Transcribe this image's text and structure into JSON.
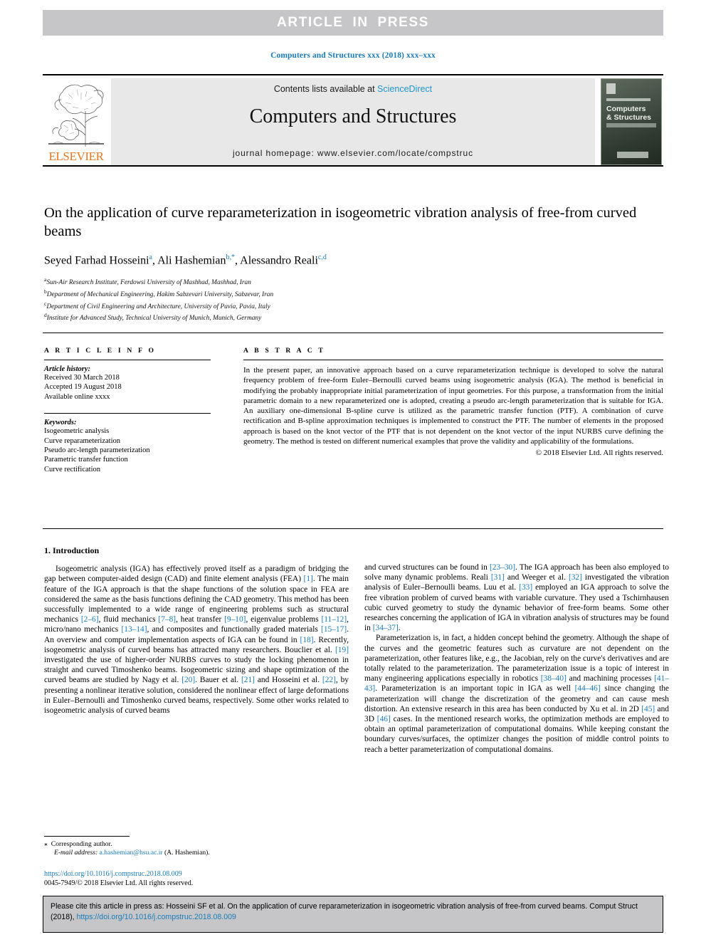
{
  "banner": {
    "text": "ARTICLE IN PRESS"
  },
  "journal_citation": "Computers and Structures xxx (2018) xxx–xxx",
  "masthead": {
    "contents_prefix": "Contents lists available at ",
    "sciencedirect": "ScienceDirect",
    "journal_name": "Computers and Structures",
    "homepage": "journal homepage: www.elsevier.com/locate/compstruc",
    "publisher_logo_text": "ELSEVIER",
    "cover": {
      "title_line1": "Computers",
      "title_line2": "& Structures"
    }
  },
  "article": {
    "title": "On the application of curve reparameterization in isogeometric vibration analysis of free-from curved beams",
    "authors_html": "Seyed Farhad Hosseini<sup>a</sup>, Ali Hashemian<sup>b,*</sup>, Alessandro Reali<sup>c,d</sup>",
    "affiliations": [
      {
        "marker": "a",
        "text": "Sun-Air Research Institute, Ferdowsi University of Mashhad, Mashhad, Iran"
      },
      {
        "marker": "b",
        "text": "Department of Mechanical Engineering, Hakim Sabzevari University, Sabzevar, Iran"
      },
      {
        "marker": "c",
        "text": "Department of Civil Engineering and Architecture, University of Pavia, Pavia, Italy"
      },
      {
        "marker": "d",
        "text": "Institute for Advanced Study, Technical University of Munich, Munich, Germany"
      }
    ]
  },
  "article_info": {
    "heading": "A R T I C L E   I N F O",
    "history_label": "Article history:",
    "history": [
      "Received 30 March 2018",
      "Accepted 19 August 2018",
      "Available online xxxx"
    ],
    "keywords_label": "Keywords:",
    "keywords": [
      "Isogeometric analysis",
      "Curve reparameterization",
      "Pseudo arc-length parameterization",
      "Parametric transfer function",
      "Curve rectification"
    ]
  },
  "abstract": {
    "heading": "A B S T R A C T",
    "text": "In the present paper, an innovative approach based on a curve reparameterization technique is developed to solve the natural frequency problem of free-form Euler–Bernoulli curved beams using isogeometric analysis (IGA). The method is beneficial in modifying the probably inappropriate initial parameterization of input geometries. For this purpose, a transformation from the initial parametric domain to a new reparameterized one is adopted, creating a pseudo arc-length parameterization that is suitable for IGA. An auxiliary one-dimensional B-spline curve is utilized as the parametric transfer function (PTF). A combination of curve rectification and B-spline approximation techniques is implemented to construct the PTF. The number of elements in the proposed approach is based on the knot vector of the PTF that is not dependent on the knot vector of the input NURBS curve defining the geometry. The method is tested on different numerical examples that prove the validity and applicability of the formulations.",
    "copyright": "© 2018 Elsevier Ltd. All rights reserved."
  },
  "body": {
    "section_title": "1. Introduction",
    "left_paragraphs_html": [
      "Isogeometric analysis (IGA) has effectively proved itself as a paradigm of bridging the gap between computer-aided design (CAD) and finite element analysis (FEA) <span class=\"ref\">[1]</span>. The main feature of the IGA approach is that the shape functions of the solution space in FEA are considered the same as the basis functions defining the CAD geometry. This method has been successfully implemented to a wide range of engineering problems such as structural mechanics <span class=\"ref\">[2&#8211;6]</span>, fluid mechanics <span class=\"ref\">[7&#8211;8]</span>, heat transfer <span class=\"ref\">[9&#8211;10]</span>, eigenvalue problems <span class=\"ref\">[11&#8211;12]</span>, micro/nano mechanics <span class=\"ref\">[13&#8211;14]</span>, and composites and functionally graded materials <span class=\"ref\">[15&#8211;17]</span>. An overview and computer implementation aspects of IGA can be found in <span class=\"ref\">[18]</span>. Recently, isogeometric analysis of curved beams has attracted many researchers. Bouclier et al. <span class=\"ref\">[19]</span> investigated the use of higher-order NURBS curves to study the locking phenomenon in straight and curved Timoshenko beams. Isogeometric sizing and shape optimization of the curved beams are studied by Nagy et al. <span class=\"ref\">[20]</span>. Bauer et al. <span class=\"ref\">[21]</span> and Hosseini et al. <span class=\"ref\">[22]</span>, by presenting a nonlinear iterative solution, considered the nonlinear effect of large deformations in Euler&#8211;Bernoulli and Timoshenko curved beams, respectively. Some other works related to isogeometric analysis of curved beams"
    ],
    "right_paragraphs_html": [
      "and curved structures can be found in <span class=\"ref\">[23&#8211;30]</span>. The IGA approach has been also employed to solve many dynamic problems. Reali <span class=\"ref\">[31]</span> and Weeger et al. <span class=\"ref\">[32]</span> investigated the vibration analysis of Euler&#8211;Bernoulli beams. Luu et al. <span class=\"ref\">[33]</span> employed an IGA approach to solve the free vibration problem of curved beams with variable curvature. They used a Tschirnhausen cubic curved geometry to study the dynamic behavior of free-form beams. Some other researches concerning the application of IGA in vibration analysis of structures may be found in <span class=\"ref\">[34&#8211;37]</span>.",
      "Parameterization is, in fact, a hidden concept behind the geometry. Although the shape of the curves and the geometric features such as curvature are not dependent on the parameterization, other features like, e.g., the Jacobian, rely on the curve's derivatives and are totally related to the parameterization. The parameterization issue is a topic of interest in many engineering applications especially in robotics <span class=\"ref\">[38&#8211;40]</span> and machining processes <span class=\"ref\">[41&#8211;43]</span>. Parameterization is an important topic in IGA as well <span class=\"ref\">[44&#8211;46]</span> since changing the parameterization will change the discretization of the geometry and can cause mesh distortion. An extensive research in this area has been conducted by Xu et al. in 2D <span class=\"ref\">[45]</span> and 3D <span class=\"ref\">[46]</span> cases. In the mentioned research works, the optimization methods are employed to obtain an optimal parameterization of computational domains. While keeping constant the boundary curves/surfaces, the optimizer changes the position of middle control points to reach a better parameterization of computational domains."
    ]
  },
  "footnote": {
    "star": "⁎",
    "corresponding": "Corresponding author.",
    "email_label": "E-mail address:",
    "email": "a.hashemian@hsu.ac.ir",
    "email_suffix": "(A. Hashemian)."
  },
  "doi_block": {
    "doi": "https://doi.org/10.1016/j.compstruc.2018.08.009",
    "issn_line": "0045-7949/© 2018 Elsevier Ltd. All rights reserved."
  },
  "citation_footer": {
    "prefix": "Please cite this article in press as: Hosseini SF et al. On the application of curve reparameterization in isogeometric vibration analysis of free-from curved beams. Comput Struct (2018), ",
    "doi": "https://doi.org/10.1016/j.compstruc.2018.08.009"
  },
  "colors": {
    "link_blue": "#1a7bb9",
    "sciencedirect_blue": "#2196cf",
    "elsevier_orange": "#e8761a",
    "band_gray": "#c6c6c8",
    "panel_gray": "#e8e8e8"
  }
}
